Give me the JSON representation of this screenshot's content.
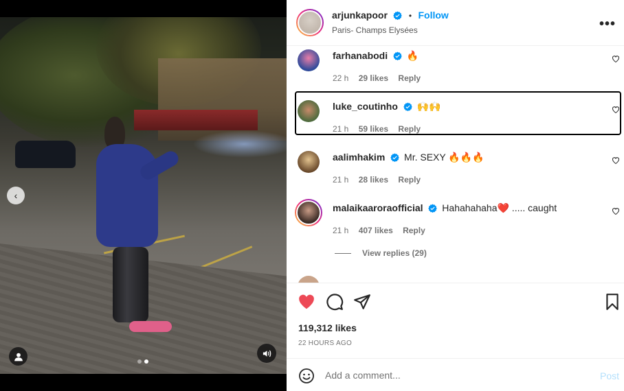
{
  "post": {
    "author": "arjunkapoor",
    "follow_label": "Follow",
    "separator": "•",
    "location": "Paris- Champs Elysées",
    "more_label": "•••"
  },
  "media": {
    "prev_arrow": "‹",
    "carousel_count": 2,
    "carousel_active": 2
  },
  "comments": [
    {
      "username": "farhanabodi",
      "verified": true,
      "text": "🔥",
      "time": "22 h",
      "likes": "29 likes",
      "reply": "Reply"
    },
    {
      "username": "luke_coutinho",
      "verified": true,
      "text": "🙌🙌",
      "time": "21 h",
      "likes": "59 likes",
      "reply": "Reply"
    },
    {
      "username": "aalimhakim",
      "verified": true,
      "text": "Mr. SEXY 🔥🔥🔥",
      "time": "21 h",
      "likes": "28 likes",
      "reply": "Reply"
    },
    {
      "username": "malaikaaroraofficial",
      "verified": true,
      "text": "Hahahahaha❤️ ..... caught",
      "time": "21 h",
      "likes": "407 likes",
      "reply": "Reply"
    }
  ],
  "view_replies": "View replies (29)",
  "stats": {
    "likes": "119,312 likes",
    "posted": "22 HOURS AGO"
  },
  "composer": {
    "placeholder": "Add a comment...",
    "post_label": "Post"
  },
  "colors": {
    "accent": "#0095f6",
    "like_red": "#ed4956",
    "verified": "#0095f6"
  }
}
